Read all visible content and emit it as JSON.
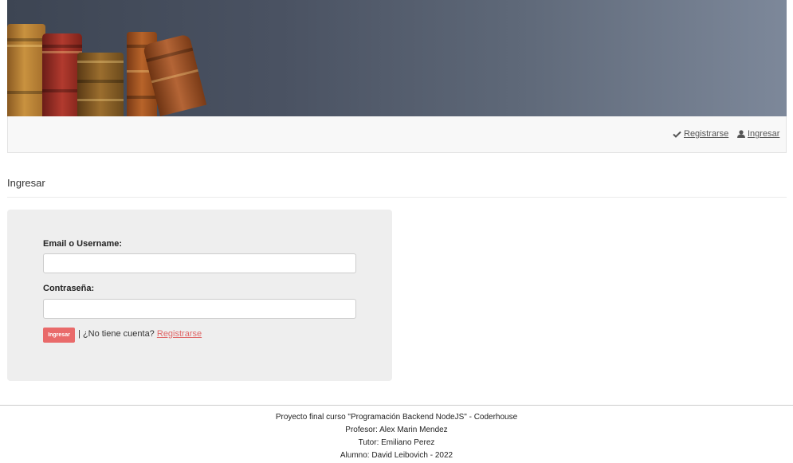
{
  "navbar": {
    "register_label": "Registrarse",
    "login_label": "Ingresar"
  },
  "page": {
    "heading": "Ingresar"
  },
  "form": {
    "email_label": "Email o Username:",
    "email_value": "",
    "password_label": "Contraseña:",
    "password_value": "",
    "submit_label": "Ingresar",
    "no_account_text": "| ¿No tiene cuenta?",
    "register_link": "Registrarse"
  },
  "footer": {
    "line1": "Proyecto final curso \"Programación Backend NodeJS\" - Coderhouse",
    "line2": "Profesor: Alex Marin Mendez",
    "line3": "Tutor: Emiliano Perez",
    "line4": "Alumno: David Leibovich - 2022"
  },
  "colors": {
    "accent": "#e96a6a",
    "link": "#e06767",
    "navbar_bg": "#f8f8f8",
    "panel_bg": "#eeeeee"
  },
  "icons": {
    "register": "check-icon",
    "login": "user-icon"
  }
}
